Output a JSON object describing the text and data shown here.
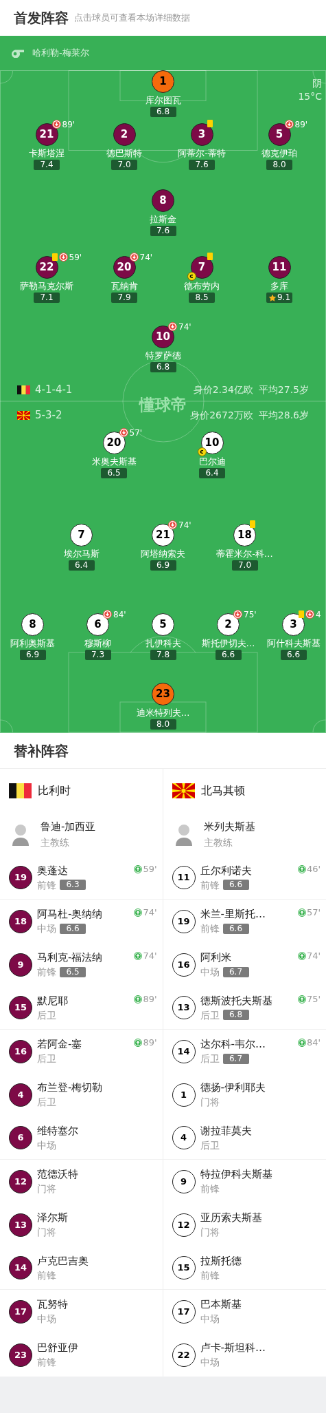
{
  "header": {
    "title": "首发阵容",
    "hint": "点击球员可查看本场详细数据"
  },
  "pitch": {
    "referee": "哈利勒-梅莱尔",
    "weather": "阴",
    "temperature": "15°C",
    "logo": "懂球帝",
    "home": {
      "kind": "home",
      "formation": "4-1-4-1",
      "value": "身价2.34亿欧",
      "avg_age": "平均27.5岁",
      "lines": [
        {
          "kind": "goalkeeper",
          "players": [
            {
              "number": "1",
              "name": "库尔图瓦",
              "rating": "6.8",
              "yellow_card": false,
              "best": false
            }
          ]
        },
        {
          "kind": "outfield",
          "players": [
            {
              "number": "21",
              "name": "卡斯塔涅",
              "rating": "7.4",
              "yellow_card": false,
              "best": false,
              "sub_off": "89'"
            },
            {
              "number": "2",
              "name": "德巴斯特",
              "rating": "7.0",
              "yellow_card": false,
              "best": false
            },
            {
              "number": "3",
              "name": "阿蒂尔-蒂特",
              "rating": "7.6",
              "yellow_card": true,
              "best": false
            },
            {
              "number": "5",
              "name": "德克伊珀",
              "rating": "8.0",
              "yellow_card": false,
              "best": false,
              "sub_off": "89'"
            }
          ]
        },
        {
          "kind": "outfield",
          "players": [
            {
              "number": "8",
              "name": "拉斯金",
              "rating": "7.6",
              "yellow_card": false,
              "best": false
            }
          ]
        },
        {
          "kind": "outfield",
          "players": [
            {
              "number": "22",
              "name": "萨勒马克尔斯",
              "rating": "7.1",
              "yellow_card": true,
              "best": false,
              "sub_off": "59'"
            },
            {
              "number": "20",
              "name": "瓦纳肯",
              "rating": "7.9",
              "yellow_card": false,
              "best": false,
              "sub_off": "74'"
            },
            {
              "number": "7",
              "name": "德布劳内",
              "rating": "8.5",
              "yellow_card": true,
              "best": false,
              "captain_badge": "c"
            },
            {
              "number": "11",
              "name": "多库",
              "rating": "9.1",
              "yellow_card": false,
              "best": true
            }
          ]
        },
        {
          "kind": "outfield",
          "players": [
            {
              "number": "10",
              "name": "特罗萨德",
              "rating": "6.8",
              "yellow_card": false,
              "best": false,
              "sub_off": "74'"
            }
          ]
        }
      ]
    },
    "away": {
      "kind": "away",
      "formation": "5-3-2",
      "value": "身价2672万欧",
      "avg_age": "平均28.6岁",
      "lines": [
        {
          "kind": "outfield",
          "players": [
            {
              "number": "20",
              "name": "米奥夫斯基",
              "rating": "6.5",
              "yellow_card": false,
              "best": false,
              "sub_off": "57'"
            },
            {
              "number": "10",
              "name": "巴尔迪",
              "rating": "6.4",
              "yellow_card": false,
              "best": false,
              "captain_badge": "c"
            }
          ]
        },
        {
          "kind": "outfield",
          "players": [
            {
              "number": "7",
              "name": "埃尔马斯",
              "rating": "6.4",
              "yellow_card": false,
              "best": false
            },
            {
              "number": "21",
              "name": "阿塔纳索夫",
              "rating": "6.9",
              "yellow_card": false,
              "best": false,
              "sub_off": "74'"
            },
            {
              "number": "18",
              "name": "蒂霍米尔-科…",
              "rating": "7.0",
              "yellow_card": true,
              "best": false
            }
          ]
        },
        {
          "kind": "outfield",
          "players": [
            {
              "number": "8",
              "name": "阿利奥斯基",
              "rating": "6.9",
              "yellow_card": false,
              "best": false
            },
            {
              "number": "6",
              "name": "穆斯柳",
              "rating": "7.3",
              "yellow_card": false,
              "best": false,
              "sub_off": "84'"
            },
            {
              "number": "5",
              "name": "扎伊科夫",
              "rating": "7.8",
              "yellow_card": false,
              "best": false
            },
            {
              "number": "2",
              "name": "斯托伊切夫…",
              "rating": "6.6",
              "yellow_card": false,
              "best": false,
              "sub_off": "75'"
            },
            {
              "number": "3",
              "name": "阿什科夫斯基",
              "rating": "6.6",
              "yellow_card": true,
              "best": false,
              "sub_off": "4"
            }
          ]
        },
        {
          "kind": "goalkeeper",
          "players": [
            {
              "number": "23",
              "name": "迪米特列夫…",
              "rating": "8.0",
              "yellow_card": false,
              "best": false
            }
          ]
        }
      ]
    }
  },
  "subs": {
    "title": "替补阵容",
    "teams": [
      {
        "kind": "home",
        "name": "比利时",
        "coach": {
          "name": "鲁迪-加西亚",
          "role": "主教练"
        },
        "players": [
          {
            "number": "19",
            "name": "奥蓬达",
            "position": "前锋",
            "rating": "6.3",
            "sub_on": "59'"
          },
          {
            "number": "18",
            "name": "阿马杜-奥纳纳",
            "position": "中场",
            "rating": "6.6",
            "sub_on": "74'"
          },
          {
            "number": "9",
            "name": "马利克-福法纳",
            "position": "前锋",
            "rating": "6.5",
            "sub_on": "74'"
          },
          {
            "number": "15",
            "name": "默尼耶",
            "position": "后卫",
            "sub_on": "89'"
          },
          {
            "number": "16",
            "name": "若阿金-塞",
            "position": "后卫",
            "sub_on": "89'"
          },
          {
            "number": "4",
            "name": "布兰登-梅切勒",
            "position": "后卫"
          },
          {
            "number": "6",
            "name": "维特塞尔",
            "position": "中场"
          },
          {
            "number": "12",
            "name": "范德沃特",
            "position": "门将"
          },
          {
            "number": "13",
            "name": "泽尔斯",
            "position": "门将"
          },
          {
            "number": "14",
            "name": "卢克巴吉奥",
            "position": "前锋"
          },
          {
            "number": "17",
            "name": "瓦努特",
            "position": "中场"
          },
          {
            "number": "23",
            "name": "巴舒亚伊",
            "position": "前锋"
          }
        ]
      },
      {
        "kind": "away",
        "name": "北马其顿",
        "coach": {
          "name": "米列夫斯基",
          "role": "主教练"
        },
        "players": [
          {
            "number": "11",
            "name": "丘尔利诺夫",
            "position": "前锋",
            "rating": "6.6",
            "sub_on": "46'"
          },
          {
            "number": "19",
            "name": "米兰-里斯托…",
            "position": "前锋",
            "rating": "6.6",
            "sub_on": "57'"
          },
          {
            "number": "16",
            "name": "阿利米",
            "position": "中场",
            "rating": "6.7",
            "sub_on": "74'"
          },
          {
            "number": "13",
            "name": "德斯波托夫斯基",
            "position": "后卫",
            "rating": "6.8",
            "sub_on": "75'"
          },
          {
            "number": "14",
            "name": "达尔科-韦尔…",
            "position": "后卫",
            "rating": "6.7",
            "sub_on": "84'"
          },
          {
            "number": "1",
            "name": "德扬-伊利耶夫",
            "position": "门将"
          },
          {
            "number": "4",
            "name": "谢拉菲莫夫",
            "position": "后卫"
          },
          {
            "number": "9",
            "name": "特拉伊科夫斯基",
            "position": "前锋"
          },
          {
            "number": "12",
            "name": "亚历索夫斯基",
            "position": "门将"
          },
          {
            "number": "15",
            "name": "拉斯托德",
            "position": "前锋"
          },
          {
            "number": "17",
            "name": "巴本斯基",
            "position": "中场"
          },
          {
            "number": "22",
            "name": "卢卡-斯坦科…",
            "position": "中场"
          }
        ]
      }
    ]
  }
}
